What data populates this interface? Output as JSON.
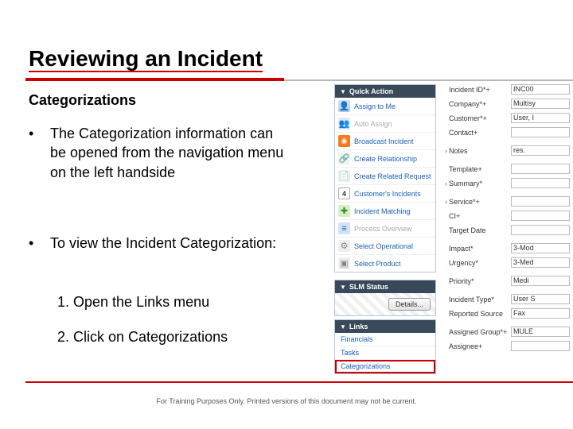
{
  "title": "Reviewing an Incident",
  "subheading": "Categorizations",
  "bullet1": "The Categorization information can be opened from the navigation menu on the left handside",
  "bullet2": "To view the Incident Categorization:",
  "step1": "1.  Open the Links menu",
  "step2": "2.  Click on Categorizations",
  "footer": "For Training Purposes Only. Printed versions of this document may not be current.",
  "quick_action": {
    "header": "Quick Action",
    "items": [
      {
        "label": "Assign to Me"
      },
      {
        "label": "Auto Assign"
      },
      {
        "label": "Broadcast Incident"
      },
      {
        "label": "Create Relationship"
      },
      {
        "label": "Create Related Request"
      },
      {
        "label": "Customer's Incidents",
        "count": "4"
      },
      {
        "label": "Incident Matching"
      },
      {
        "label": "Process Overview"
      },
      {
        "label": "Select Operational"
      },
      {
        "label": "Select Product"
      }
    ]
  },
  "slm": {
    "header": "SLM Status",
    "button": "Details..."
  },
  "links": {
    "header": "Links",
    "items": [
      "Financials",
      "Tasks",
      "Categorizations"
    ]
  },
  "form": {
    "fields": [
      {
        "label": "Incident ID*+",
        "value": "INC00"
      },
      {
        "label": "Company*+",
        "value": "Multisy"
      },
      {
        "label": "Customer*+",
        "value": "User, I"
      },
      {
        "label": "Contact+",
        "value": ""
      },
      {
        "label": "Notes",
        "value": "res.",
        "gap": true,
        "sel": true
      },
      {
        "label": "Template+",
        "value": "",
        "gap": true
      },
      {
        "label": "Summary*",
        "value": "",
        "sel": true
      },
      {
        "label": "Service*+",
        "value": "",
        "gap": true,
        "sel": true
      },
      {
        "label": "CI+",
        "value": ""
      },
      {
        "label": "Target Date",
        "value": ""
      },
      {
        "label": "Impact*",
        "value": "3-Mod",
        "gap": true
      },
      {
        "label": "Urgency*",
        "value": "3-Med"
      },
      {
        "label": "Priority*",
        "value": "Medi",
        "gap": true
      },
      {
        "label": "Incident Type*",
        "value": "User S",
        "gap": true
      },
      {
        "label": "Reported Source",
        "value": "Fax"
      },
      {
        "label": "Assigned Group*+",
        "value": "MULE",
        "gap": true
      },
      {
        "label": "Assignee+",
        "value": ""
      }
    ]
  }
}
